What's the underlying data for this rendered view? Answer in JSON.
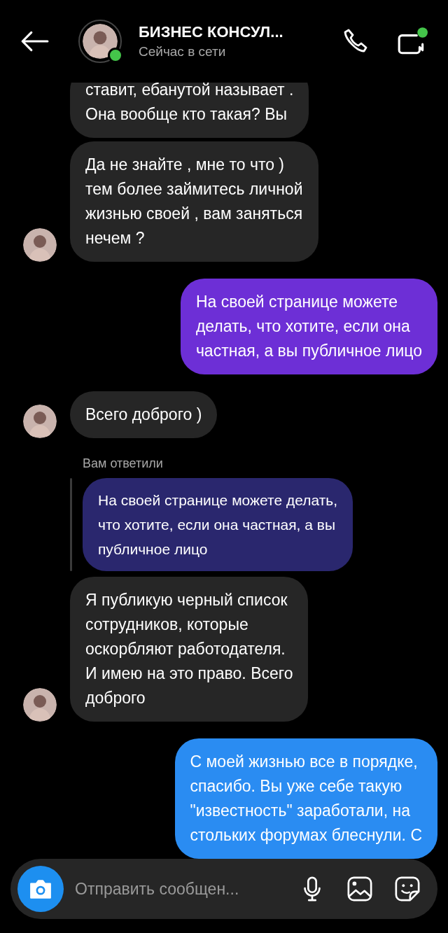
{
  "header": {
    "title": "БИЗНЕС КОНСУЛ...",
    "status": "Сейчас в сети",
    "online": true
  },
  "messages": [
    {
      "kind": "incoming",
      "text": "ставит, ебанутой называет .\nОна вообще кто такая? Вы",
      "avatar": false
    },
    {
      "kind": "incoming",
      "text": "Да не знайте , мне то что )\nтем более займитесь личной\nжизнью своей , вам заняться\nнечем ?",
      "avatar": true
    },
    {
      "kind": "outgoing",
      "text": "На своей странице можете\nделать, что хотите, если она\nчастная, а вы публичное лицо",
      "color": "#6d2fd6"
    },
    {
      "kind": "incoming",
      "text": "Всего доброго )",
      "avatar": true
    },
    {
      "kind": "reply",
      "label": "Вам ответили",
      "text": "На своей странице можете делать,\nчто хотите, если она частная, а вы\nпубличное лицо"
    },
    {
      "kind": "incoming",
      "text": "Я публикую черный список\nсотрудников, которые\nоскорбляют работодателя.\nИ имею на это право. Всего\nдоброго",
      "avatar": true
    },
    {
      "kind": "outgoing",
      "text": "С моей жизнью все в порядке,\nспасибо. Вы уже себе такую\n\"известность\" заработали, на\nстольких форумах блеснули. С",
      "color": "#2a8cf2"
    }
  ],
  "composer": {
    "placeholder": "Отправить сообщен..."
  }
}
